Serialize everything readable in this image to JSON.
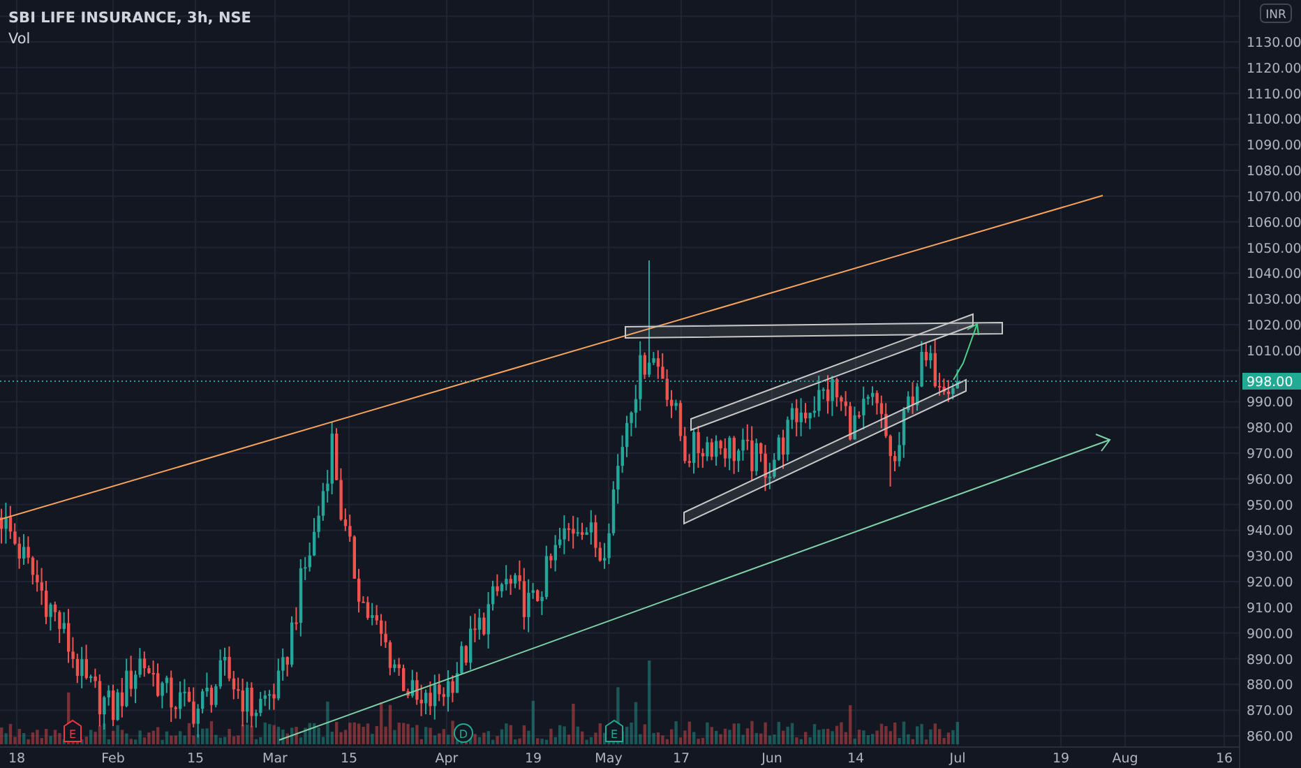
{
  "legend": {
    "title": "SBI LIFE INSURANCE, 3h, NSE",
    "volume_label": "Vol"
  },
  "price_axis": {
    "currency": "INR",
    "ticks": [
      "1130.00",
      "1120.00",
      "1110.00",
      "1100.00",
      "1090.00",
      "1080.00",
      "1070.00",
      "1060.00",
      "1050.00",
      "1040.00",
      "1030.00",
      "1020.00",
      "1010.00",
      "990.00",
      "980.00",
      "970.00",
      "960.00",
      "950.00",
      "940.00",
      "930.00",
      "920.00",
      "910.00",
      "900.00",
      "890.00",
      "880.00",
      "870.00",
      "860.00"
    ],
    "last_price": "998.00"
  },
  "time_axis": {
    "labels": [
      "18",
      "Feb",
      "15",
      "Mar",
      "15",
      "Apr",
      "19",
      "May",
      "17",
      "Jun",
      "14",
      "Jul",
      "19",
      "Aug",
      "16"
    ]
  },
  "events": [
    {
      "label": "E",
      "kind": "earnings",
      "color": "#f23645"
    },
    {
      "label": "D",
      "kind": "dividend",
      "color": "#22ab94"
    },
    {
      "label": "E",
      "kind": "earnings",
      "color": "#22ab94"
    }
  ]
}
